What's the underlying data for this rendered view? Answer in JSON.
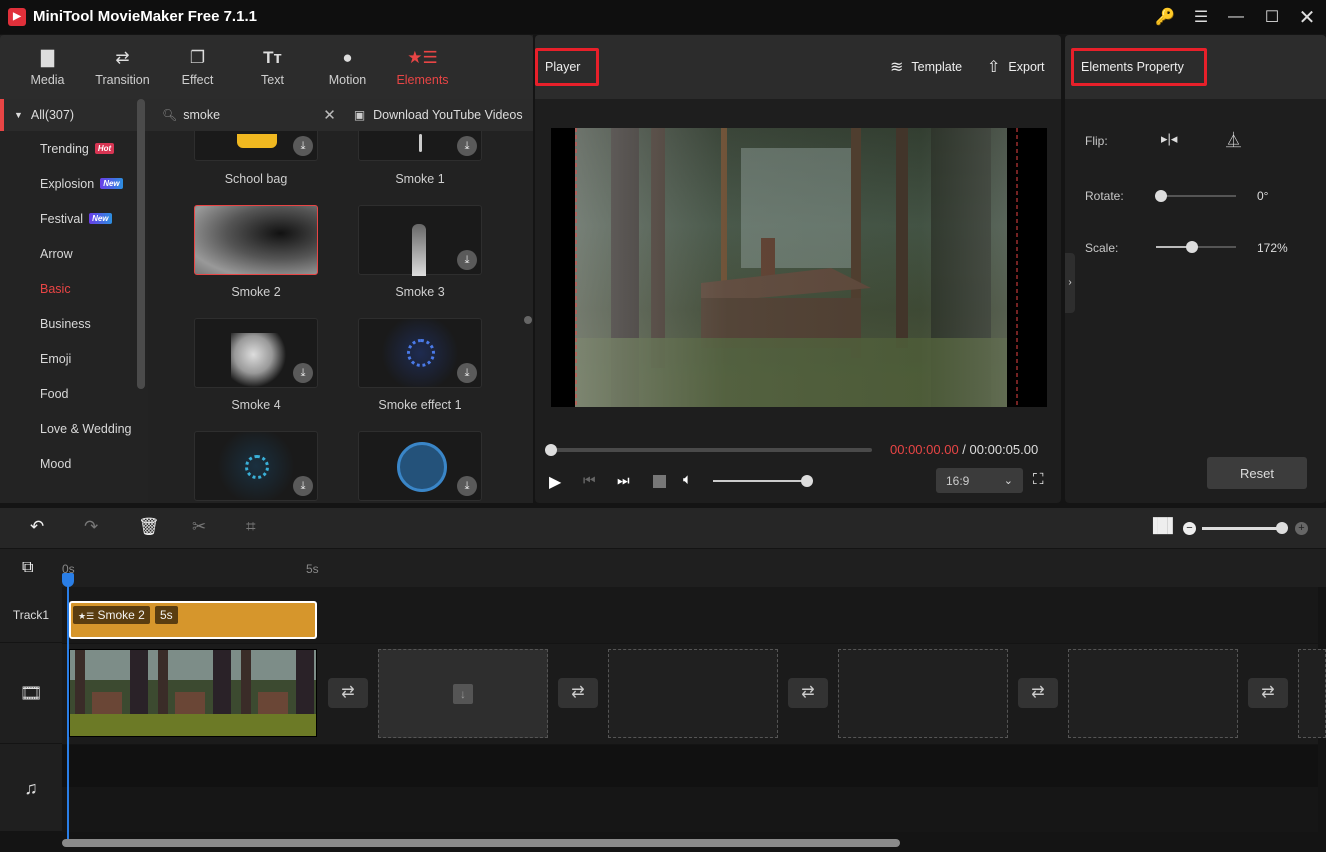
{
  "app": {
    "title": "MiniTool MovieMaker Free 7.1.1",
    "logo_icon": "app-logo-icon",
    "window_controls": [
      "key-icon",
      "menu-icon",
      "minimize-icon",
      "maximize-icon",
      "close-icon"
    ]
  },
  "toolbar": {
    "tabs": [
      {
        "label": "Media",
        "icon": "folder-icon"
      },
      {
        "label": "Transition",
        "icon": "swap-arrows-icon"
      },
      {
        "label": "Effect",
        "icon": "layers-square-icon"
      },
      {
        "label": "Text",
        "icon": "text-tt-icon"
      },
      {
        "label": "Motion",
        "icon": "motion-balls-icon"
      },
      {
        "label": "Elements",
        "icon": "star-list-icon",
        "active": true
      }
    ]
  },
  "categories": {
    "all_label": "All(307)",
    "items": [
      {
        "label": "Trending",
        "badge": "Hot"
      },
      {
        "label": "Explosion",
        "badge": "New"
      },
      {
        "label": "Festival",
        "badge": "New"
      },
      {
        "label": "Arrow"
      },
      {
        "label": "Basic",
        "active": true
      },
      {
        "label": "Business"
      },
      {
        "label": "Emoji"
      },
      {
        "label": "Food"
      },
      {
        "label": "Love & Wedding"
      },
      {
        "label": "Mood"
      }
    ]
  },
  "search": {
    "value": "smoke",
    "download_label": "Download YouTube Videos"
  },
  "elements": [
    {
      "label": "School bag"
    },
    {
      "label": "Smoke 1"
    },
    {
      "label": "Smoke 2",
      "selected": true
    },
    {
      "label": "Smoke 3"
    },
    {
      "label": "Smoke 4"
    },
    {
      "label": "Smoke effect 1"
    },
    {
      "label": ""
    },
    {
      "label": ""
    }
  ],
  "player": {
    "title": "Player",
    "template_label": "Template",
    "export_label": "Export",
    "current_time": "00:00:00.00",
    "separator": " / ",
    "total_time": "00:00:05.00",
    "progress": 0,
    "volume": 1.0,
    "aspect_ratio": "16:9"
  },
  "properties": {
    "title": "Elements Property",
    "flip_label": "Flip:",
    "rotate_label": "Rotate:",
    "rotate_value": "0°",
    "rotate_fraction": 0.0,
    "scale_label": "Scale:",
    "scale_value": "172%",
    "scale_fraction": 0.45,
    "reset_label": "Reset"
  },
  "timeline": {
    "ruler": [
      "0s",
      "5s"
    ],
    "zoom_fraction": 1.0,
    "track1_label": "Track1",
    "element_clip": {
      "name": "Smoke 2",
      "duration": "5s"
    }
  },
  "colors": {
    "accent": "#e84545",
    "playhead": "#2a7ee6",
    "element_clip": "#d6962c"
  }
}
